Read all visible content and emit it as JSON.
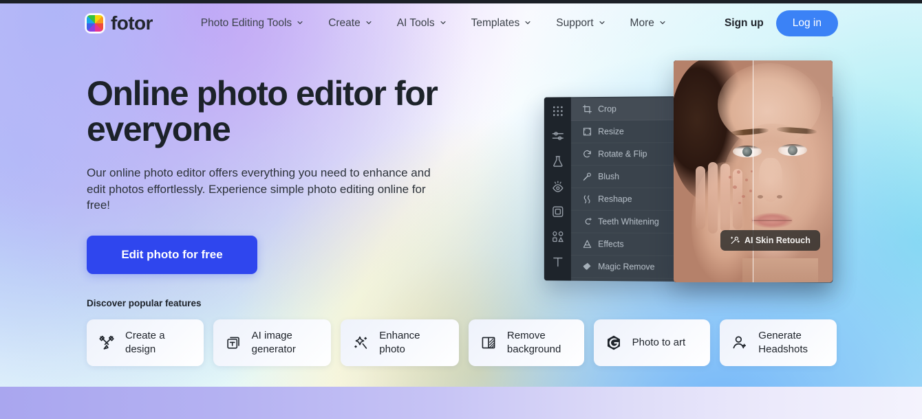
{
  "brand": {
    "name": "fotor",
    "logo_icon": "fotor-color-wheel-logo"
  },
  "nav": {
    "items": [
      {
        "label": "Photo Editing Tools",
        "caret_icon": "chevron-down-icon"
      },
      {
        "label": "Create",
        "caret_icon": "chevron-down-icon"
      },
      {
        "label": "AI Tools",
        "caret_icon": "chevron-down-icon"
      },
      {
        "label": "Templates",
        "caret_icon": "chevron-down-icon"
      },
      {
        "label": "Support",
        "caret_icon": "chevron-down-icon"
      },
      {
        "label": "More",
        "caret_icon": "chevron-down-icon"
      }
    ],
    "signup_label": "Sign up",
    "login_label": "Log in",
    "login_color": "#3b82f6"
  },
  "hero": {
    "title": "Online photo editor for everyone",
    "subtitle": "Our online photo editor offers everything you need to enhance and edit photos effortlessly. Experience simple photo editing online for free!",
    "cta_label": "Edit photo for free",
    "cta_color": "#2f46ee"
  },
  "features": {
    "label": "Discover popular features",
    "cards": [
      {
        "label": "Create a\ndesign",
        "icon": "crossed-pencil-brush-icon"
      },
      {
        "label": "AI image\ngenerator",
        "icon": "image-stack-text-icon"
      },
      {
        "label": "Enhance\nphoto",
        "icon": "magic-wand-sparkle-icon"
      },
      {
        "label": "Remove\nbackground",
        "icon": "background-split-icon"
      },
      {
        "label": "Photo to art",
        "icon": "hexagon-g-icon"
      },
      {
        "label": "Generate\nHeadshots",
        "icon": "person-plus-icon"
      }
    ]
  },
  "editor_mock": {
    "sidebar_icons": [
      "grid-dots-icon",
      "sliders-icon",
      "flask-icon",
      "eye-sparkle-icon",
      "frame-icon",
      "shapes-icon",
      "text-tool-icon"
    ],
    "tools": [
      {
        "label": "Crop",
        "icon": "crop-icon",
        "active": true
      },
      {
        "label": "Resize",
        "icon": "resize-icon",
        "active": false
      },
      {
        "label": "Rotate & Flip",
        "icon": "rotate-icon",
        "active": false
      },
      {
        "label": "Blush",
        "icon": "blush-icon",
        "active": false
      },
      {
        "label": "Reshape",
        "icon": "reshape-icon",
        "active": false
      },
      {
        "label": "Teeth Whitening",
        "icon": "teeth-icon",
        "active": false
      },
      {
        "label": "Effects",
        "icon": "effects-icon",
        "active": false
      },
      {
        "label": "Magic Remove",
        "icon": "magic-remove-icon",
        "active": false
      }
    ]
  },
  "photo_panel": {
    "tooltip_label": "AI Skin Retouch",
    "tooltip_icon": "ai-retouch-wand-icon",
    "comparison": "before-after-split"
  }
}
